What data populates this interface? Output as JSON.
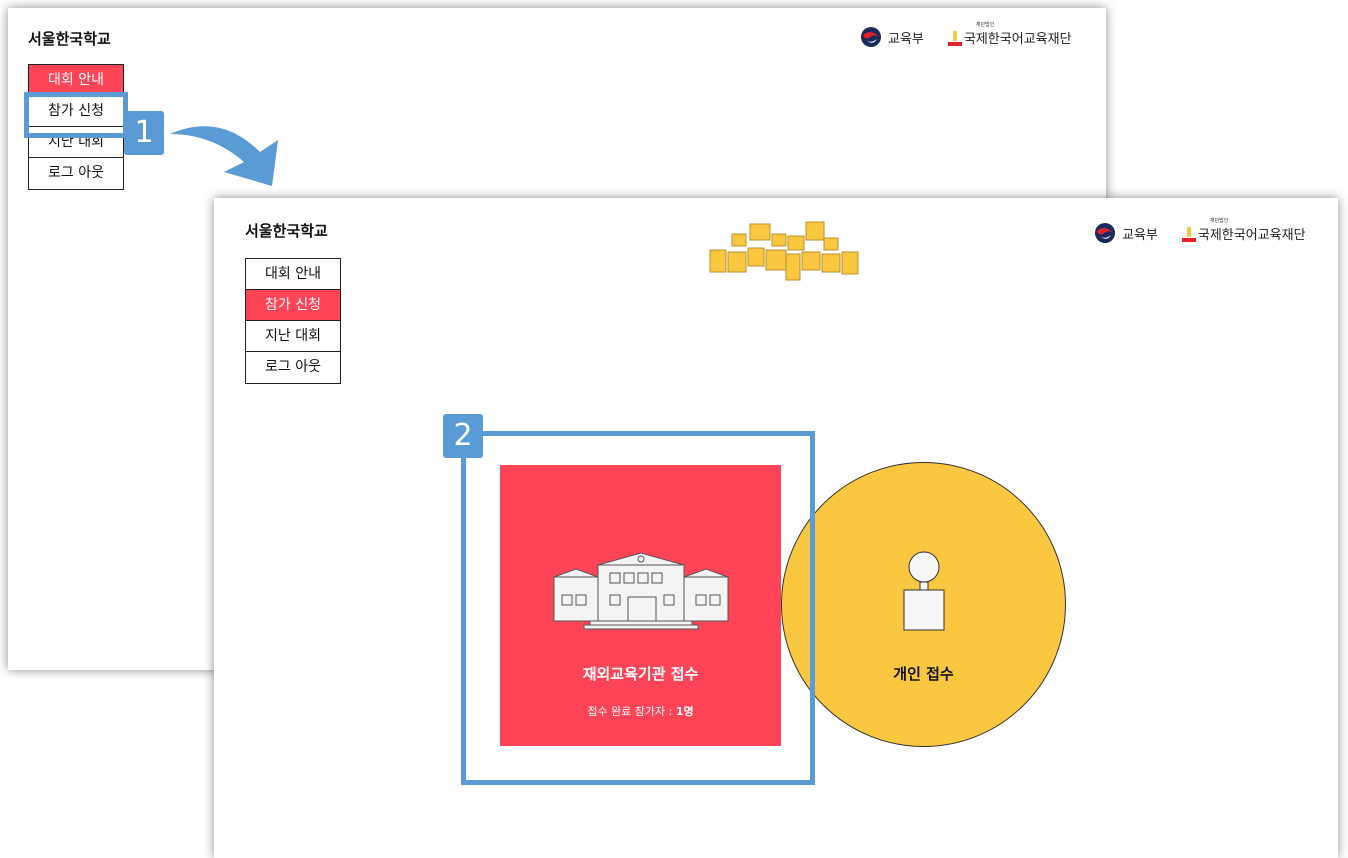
{
  "back_panel": {
    "school": "서울한국학교",
    "menu": [
      "대회 안내",
      "참가 신청",
      "지난 대회",
      "로그 아웃"
    ],
    "active_index": 0,
    "logos": {
      "ministry": "교육부",
      "foundation": "국제한국어교육재단",
      "foundation_sub": "재단법인"
    }
  },
  "front_panel": {
    "school": "서울한국학교",
    "menu": [
      "대회 안내",
      "참가 신청",
      "지난 대회",
      "로그 아웃"
    ],
    "active_index": 1,
    "logos": {
      "ministry": "교육부",
      "foundation": "국제한국어교육재단",
      "foundation_sub": "재단법인"
    },
    "emblem_icon": "competition-emblem-logo",
    "cards": {
      "institution": {
        "title": "재외교육기관 접수",
        "sub_prefix": "접수 완료 참가자 : ",
        "sub_count": "1명",
        "icon": "school-building-icon"
      },
      "individual": {
        "title": "개인 접수",
        "icon": "person-icon"
      }
    }
  },
  "annotations": {
    "step1": "1",
    "step2": "2"
  },
  "colors": {
    "accent_red": "#ff4457",
    "accent_yellow": "#f9c740",
    "annotation_blue": "#5b9bd5"
  }
}
